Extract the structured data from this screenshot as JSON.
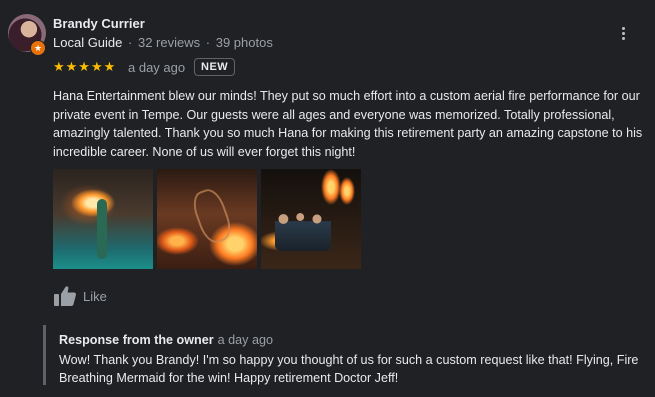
{
  "reviewer": {
    "name": "Brandy Currier",
    "guide_label": "Local Guide",
    "separator": "·",
    "reviews": "32 reviews",
    "photos": "39 photos",
    "badge_icon": "local-guide-star-icon"
  },
  "rating": {
    "value": 5,
    "max": 5,
    "stars": "★★★★★"
  },
  "review": {
    "date": "a day ago",
    "new_badge": "NEW",
    "text": "Hana Entertainment blew our minds! They put so much effort into a custom aerial fire performance for our private event in Tempe. Our guests were all ages and everyone was memorized. Totally professional, amazingly talented. Thank you so much Hana for making this retirement party an amazing capstone to his incredible career. None of us will ever forget this night!"
  },
  "photos": [
    {
      "name": "review-photo-1"
    },
    {
      "name": "review-photo-2"
    },
    {
      "name": "review-photo-3"
    }
  ],
  "actions": {
    "like_label": "Like",
    "like_icon": "thumbs-up-icon",
    "more_icon": "more-vert-icon"
  },
  "owner_response": {
    "heading": "Response from the owner",
    "date": "a day ago",
    "text": "Wow! Thank you Brandy! I'm so happy you thought of us for such a custom request like that! Flying, Fire Breathing Mermaid for the win! Happy retirement Doctor Jeff!"
  },
  "colors": {
    "background": "#202124",
    "star": "#fbbc04",
    "guide_badge": "#e8710a",
    "muted_text": "#9aa0a6"
  }
}
